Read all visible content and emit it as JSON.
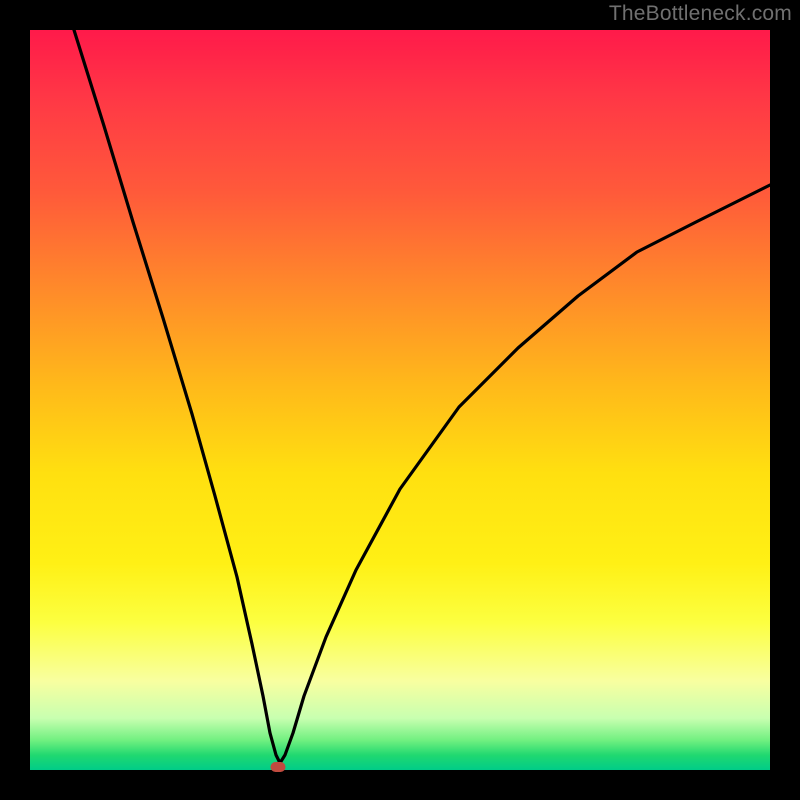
{
  "watermark": "TheBottleneck.com",
  "colors": {
    "frame": "#000000",
    "curve": "#000000",
    "marker": "#c14b3f",
    "watermark": "#707070"
  },
  "chart_data": {
    "type": "line",
    "title": "",
    "xlabel": "",
    "ylabel": "",
    "xlim": [
      0,
      100
    ],
    "ylim": [
      0,
      100
    ],
    "grid": false,
    "series": [
      {
        "name": "bottleneck-curve",
        "x": [
          6,
          10,
          14,
          18,
          22,
          25,
          28,
          30,
          31.5,
          32.5,
          33.2,
          33.8,
          34.5,
          35.5,
          37,
          40,
          44,
          50,
          58,
          66,
          74,
          82,
          90,
          96,
          100
        ],
        "y": [
          100,
          87,
          74,
          61,
          48,
          37,
          26,
          17,
          10,
          5,
          2,
          1,
          2,
          5,
          10,
          18,
          27,
          38,
          49,
          57,
          64,
          70,
          74,
          77,
          79
        ]
      }
    ],
    "marker": {
      "x": 33.5,
      "y": 0.2
    },
    "gradient_stops": [
      {
        "pos": 0,
        "color": "#ff1a4a"
      },
      {
        "pos": 50,
        "color": "#ffe010"
      },
      {
        "pos": 90,
        "color": "#f8ffa0"
      },
      {
        "pos": 100,
        "color": "#00cc88"
      }
    ]
  }
}
